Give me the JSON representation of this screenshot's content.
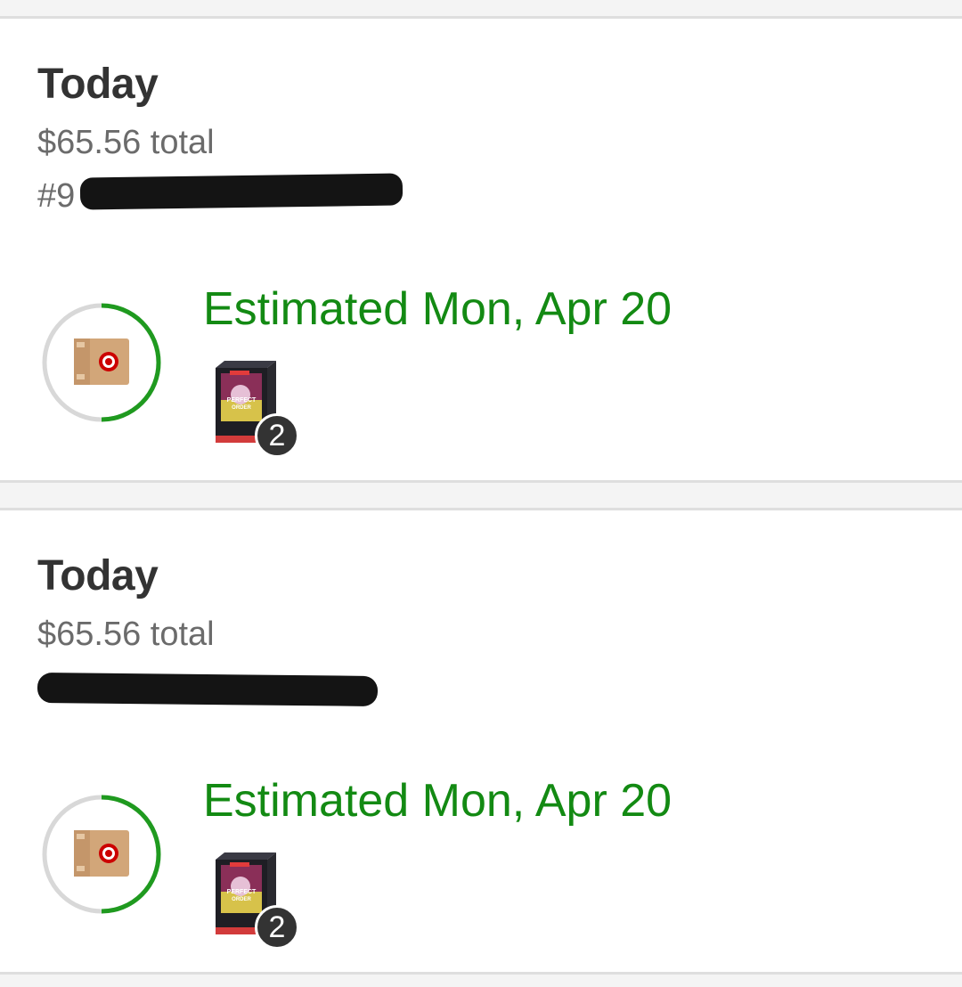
{
  "orders": [
    {
      "date_label": "Today",
      "total_label": "$65.56 total",
      "order_number": "#9",
      "estimate_label": "Estimated Mon, Apr 20",
      "item_count": "2",
      "progress_percent": 50,
      "product_art_text": "PERFECT ORDER"
    },
    {
      "date_label": "Today",
      "total_label": "$65.56 total",
      "order_number": "",
      "estimate_label": "Estimated Mon, Apr 20",
      "item_count": "2",
      "progress_percent": 50,
      "product_art_text": "PERFECT ORDER"
    }
  ],
  "colors": {
    "estimate_green": "#138a13",
    "progress_green": "#1f9a1f",
    "progress_track": "#d8d8d8",
    "badge_dark": "#333333",
    "box_tan": "#d2a679",
    "target_red": "#cc0000"
  },
  "icons": {
    "status": "package-box-icon",
    "logo": "target-bullseye-icon"
  }
}
